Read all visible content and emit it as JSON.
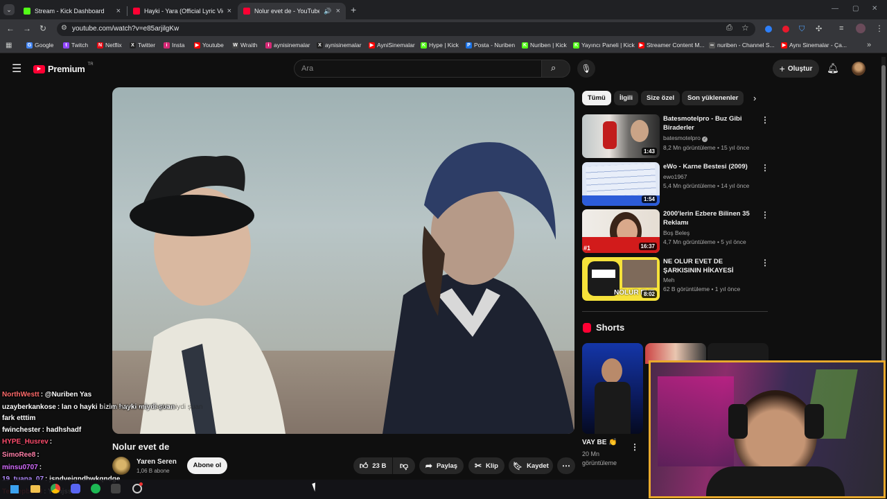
{
  "browser": {
    "tabs": [
      {
        "label": "Stream - Kick Dashboard",
        "favicon": "kick-icon"
      },
      {
        "label": "Hayki - Yara (Official Lyric Video)",
        "favicon": "youtube-icon"
      },
      {
        "label": "Nolur evet de - YouTube",
        "favicon": "youtube-icon",
        "active": true
      }
    ],
    "url": "youtube.com/watch?v=e85arjilgKw",
    "bookmarks": [
      {
        "label": "Google",
        "icon": "G",
        "color": "#4285f4"
      },
      {
        "label": "Twitch",
        "icon": "t",
        "color": "#9146ff"
      },
      {
        "label": "Netflix",
        "icon": "N",
        "color": "#e50914"
      },
      {
        "label": "Twitter",
        "icon": "X",
        "color": "#222222"
      },
      {
        "label": "Insta",
        "icon": "i",
        "color": "#d62976"
      },
      {
        "label": "Youtube",
        "icon": "▶",
        "color": "#ff0000"
      },
      {
        "label": "Wraith",
        "icon": "W",
        "color": "#444444"
      },
      {
        "label": "aynisinemalar",
        "icon": "i",
        "color": "#d62976"
      },
      {
        "label": "aynisinemalar",
        "icon": "X",
        "color": "#222222"
      },
      {
        "label": "AyniSinemalar",
        "icon": "▶",
        "color": "#ff0000"
      },
      {
        "label": "Hype | Kick",
        "icon": "K",
        "color": "#53fc18"
      },
      {
        "label": "Posta - Nuriben",
        "icon": "P",
        "color": "#1a73e8"
      },
      {
        "label": "Nuriben | Kick",
        "icon": "K",
        "color": "#53fc18"
      },
      {
        "label": "Yayıncı Paneli | Kick",
        "icon": "K",
        "color": "#53fc18"
      },
      {
        "label": "Streamer Content M...",
        "icon": "▶",
        "color": "#ff0000"
      },
      {
        "label": "nuriben - Channel S...",
        "icon": "∞",
        "color": "#555555"
      },
      {
        "label": "Aynı Sinemalar - Ça...",
        "icon": "▶",
        "color": "#ff0000"
      }
    ]
  },
  "youtube": {
    "logo_text": "Premium",
    "logo_badge": "TR",
    "search_placeholder": "Ara",
    "create_label": "Oluştur",
    "chips": [
      "Tümü",
      "İlgili",
      "Size özel",
      "Son yüklenenler"
    ],
    "video": {
      "title": "Nolur evet de",
      "subtitle_text": "lan o hayki bizim hayki miydi şuan",
      "channel": "Yaren Seren",
      "subscribers": "1,06 B abone",
      "subscribe_label": "Abone ol",
      "likes": "23 B",
      "share_label": "Paylaş",
      "clip_label": "Klip",
      "save_label": "Kaydet"
    },
    "recommendations": [
      {
        "title": "Batesmotelpro - Buz Gibi Biraderler",
        "channel": "batesmotelpro",
        "verified": true,
        "meta": "8,2 Mn görüntüleme • 15 yıl önce",
        "duration": "1:43"
      },
      {
        "title": "eWo - Karne Bestesi (2009)",
        "channel": "ewo1967",
        "verified": false,
        "meta": "5,4 Mn görüntüleme • 14 yıl önce",
        "duration": "1:54"
      },
      {
        "title": "2000'lerin Ezbere Bilinen 35 Reklamı",
        "channel": "Boş Beleş",
        "verified": false,
        "meta": "4,7 Mn görüntüleme • 5 yıl önce",
        "duration": "16:37",
        "badge": "#1"
      },
      {
        "title": "NE OLUR EVET DE ŞARKISININ HİKAYESİ",
        "channel": "Meh",
        "verified": false,
        "meta": "62 B görüntüleme • 1 yıl önce",
        "duration": "8:02",
        "overlay": "NOLUR EVE"
      }
    ],
    "shorts": {
      "heading": "Shorts",
      "first_title": "VAY BE 👏",
      "first_views": "20 Mn görüntüleme"
    }
  },
  "chat": [
    {
      "user": "NorthWestt",
      "color": "#ff6b6b",
      "msg": ": @Nuriben Yas"
    },
    {
      "user": "uzayberkankose",
      "color": "#ffffff",
      "msg": ": lan o hayki bizim hayki miydi şuan"
    },
    {
      "user": "",
      "color": "#ffffff",
      "msg": "fark etttim"
    },
    {
      "user": "fwinchester",
      "color": "#ffffff",
      "msg": ": hadhshadf"
    },
    {
      "user": "HYPE_Husrev",
      "color": "#ff4d6d",
      "msg": ":"
    },
    {
      "user": "SimoRee8",
      "color": "#ff7fa8",
      "msg": ":"
    },
    {
      "user": "minsu0707",
      "color": "#d56cff",
      "msg": ":"
    },
    {
      "user": "19_tuana_07",
      "color": "#b38cff",
      "msg": ": jsndvejgndhwkqndge"
    },
    {
      "user": "Tellhepbdu3",
      "color": "#ff4444",
      "msg": ": Ywhjsshs"
    }
  ]
}
